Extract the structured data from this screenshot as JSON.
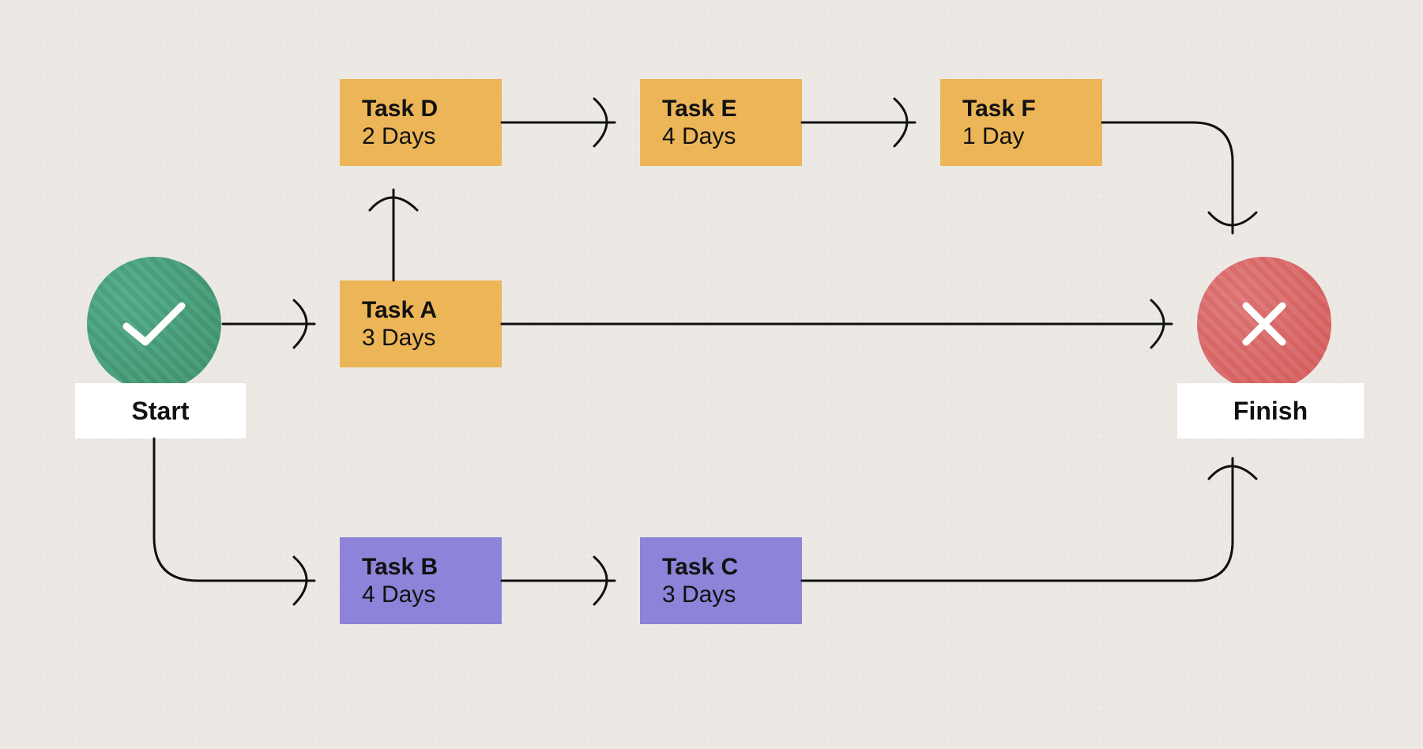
{
  "start": {
    "label": "Start",
    "color": "#4a9e7b",
    "icon": "check"
  },
  "finish": {
    "label": "Finish",
    "color": "#d96b6b",
    "icon": "cross"
  },
  "tasks": {
    "A": {
      "title": "Task A",
      "duration": "3 Days",
      "color": "orange"
    },
    "B": {
      "title": "Task B",
      "duration": "4 Days",
      "color": "purple"
    },
    "C": {
      "title": "Task C",
      "duration": "3 Days",
      "color": "purple"
    },
    "D": {
      "title": "Task D",
      "duration": "2 Days",
      "color": "orange"
    },
    "E": {
      "title": "Task E",
      "duration": "4 Days",
      "color": "orange"
    },
    "F": {
      "title": "Task F",
      "duration": "1 Day",
      "color": "orange"
    }
  },
  "edges": [
    [
      "Start",
      "A"
    ],
    [
      "Start",
      "B"
    ],
    [
      "A",
      "D"
    ],
    [
      "A",
      "Finish"
    ],
    [
      "D",
      "E"
    ],
    [
      "E",
      "F"
    ],
    [
      "F",
      "Finish"
    ],
    [
      "B",
      "C"
    ],
    [
      "C",
      "Finish"
    ]
  ]
}
